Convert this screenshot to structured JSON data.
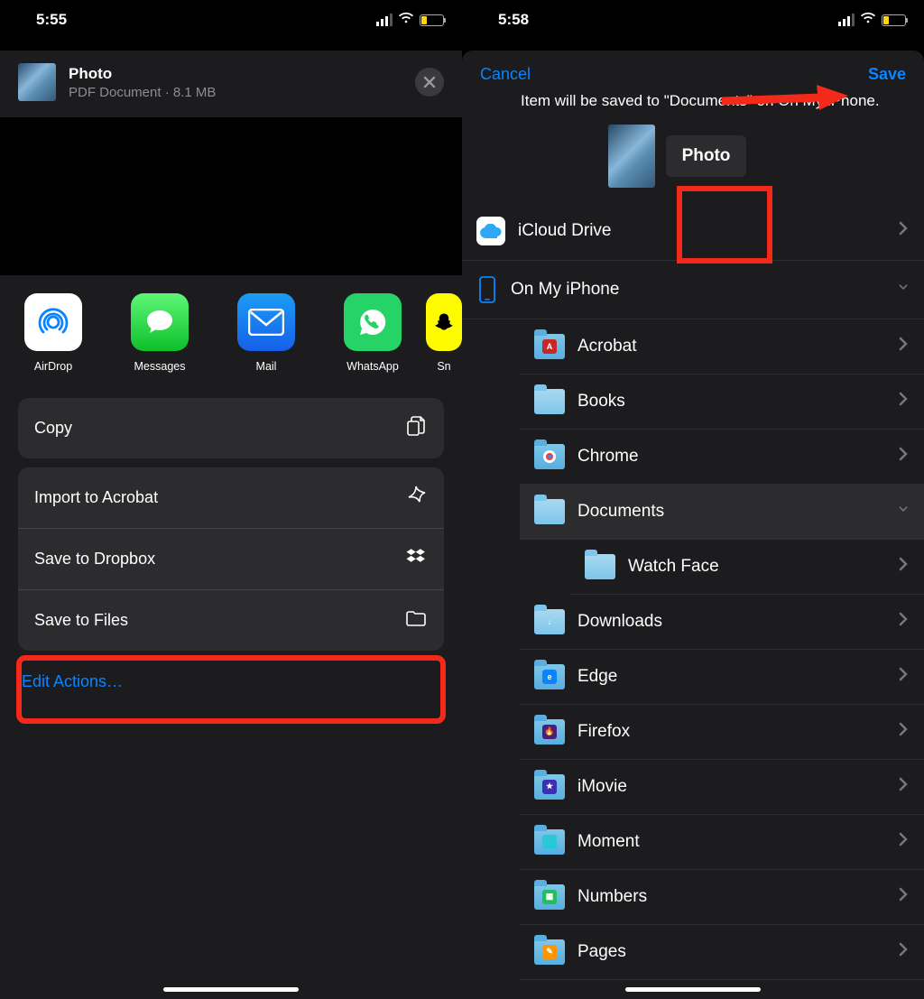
{
  "left": {
    "time": "5:55",
    "file": {
      "title": "Photo",
      "subtitle": "PDF Document · 8.1 MB"
    },
    "apps": [
      {
        "name": "AirDrop"
      },
      {
        "name": "Messages"
      },
      {
        "name": "Mail"
      },
      {
        "name": "WhatsApp"
      },
      {
        "name": "Snapchat"
      }
    ],
    "actions": {
      "copy": "Copy",
      "import_acrobat": "Import to Acrobat",
      "save_dropbox": "Save to Dropbox",
      "save_files": "Save to Files",
      "edit": "Edit Actions…"
    }
  },
  "right": {
    "time": "5:58",
    "cancel": "Cancel",
    "save": "Save",
    "info_text": "Item will be saved to \"Documents\" on On My iPhone.",
    "filename": "Photo",
    "locations": {
      "icloud": "iCloud Drive",
      "on_my_iphone": "On My iPhone"
    },
    "folders": [
      {
        "label": "Acrobat",
        "badge_color": "#c62828",
        "badge_text": "A"
      },
      {
        "label": "Books",
        "light": true
      },
      {
        "label": "Chrome",
        "badge_color": "#fff",
        "badge_multi": true
      },
      {
        "label": "Documents",
        "light": true,
        "active": true
      },
      {
        "label": "Watch Face",
        "sub": true,
        "light": true
      },
      {
        "label": "Downloads",
        "light": true,
        "badge_text": "↓"
      },
      {
        "label": "Edge",
        "badge_color": "#0a84ff",
        "badge_text": "e"
      },
      {
        "label": "Firefox",
        "badge_color": "#4a1e7a",
        "badge_text": "🔥"
      },
      {
        "label": "iMovie",
        "badge_color": "#3d2fb5",
        "badge_text": "★"
      },
      {
        "label": "Moment",
        "badge_color": "#29c7d8"
      },
      {
        "label": "Numbers",
        "badge_color": "#1fbf5c",
        "badge_text": "▦"
      },
      {
        "label": "Pages",
        "badge_color": "#ff9500",
        "badge_text": "✎"
      }
    ]
  }
}
